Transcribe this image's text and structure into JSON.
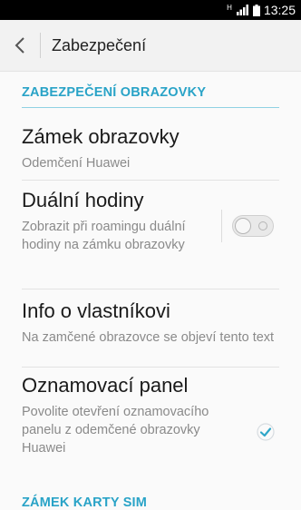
{
  "status_bar": {
    "network": "H",
    "time": "13:25"
  },
  "app_bar": {
    "back_icon": "chevron-left-icon",
    "title": "Zabezpečení"
  },
  "section": {
    "header": "ZABEZPEČENÍ OBRAZOVKY"
  },
  "items": [
    {
      "title": "Zámek obrazovky",
      "subtitle": "Odemčení Huawei"
    },
    {
      "title": "Duální hodiny",
      "subtitle": "Zobrazit při roamingu duální hodiny na zámku obrazovky",
      "toggle": "off"
    },
    {
      "title": "Info o vlastníkovi",
      "subtitle": "Na zamčené obrazovce se objeví tento text"
    },
    {
      "title": "Oznamovací panel",
      "subtitle": "Povolite otevření oznamovacího panelu z odemčené obrazovky Huawei",
      "checked": true
    }
  ],
  "next_section": {
    "header": "ZÁMEK KARTY SIM"
  },
  "colors": {
    "accent": "#29a3c7",
    "status_bar_bg": "#000000"
  }
}
